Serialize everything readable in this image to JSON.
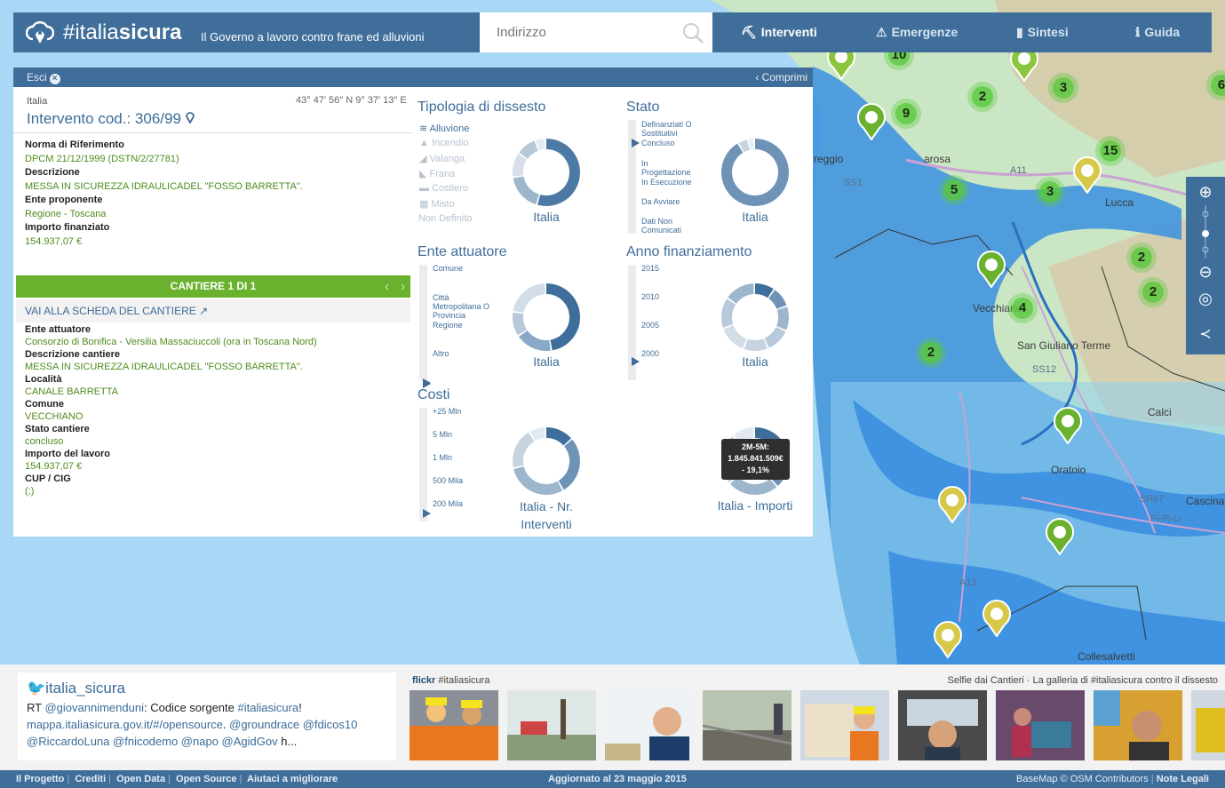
{
  "header": {
    "brand_hash": "#italia",
    "brand_bold": "sicura",
    "tagline": "Il Governo a lavoro contro frane ed alluvioni",
    "search_placeholder": "Indirizzo",
    "nav": [
      {
        "label": "Interventi",
        "icon": "worker-icon",
        "active": true
      },
      {
        "label": "Emergenze",
        "icon": "warning-icon",
        "active": false
      },
      {
        "label": "Sintesi",
        "icon": "bars-icon",
        "active": false
      },
      {
        "label": "Guida",
        "icon": "info-icon",
        "active": false
      }
    ]
  },
  "panel": {
    "exit_label": "Esci",
    "collapse_label": "Comprimi",
    "country": "Italia",
    "coords": "43° 47′ 56″ N 9° 37′ 13″ E",
    "title": "Intervento cod.: 306/99",
    "fields_top": [
      {
        "label": "Norma di Riferimento",
        "value": "DPCM 21/12/1999 (DSTN/2/27781)"
      },
      {
        "label": "Descrizione",
        "value": "MESSA IN SICUREZZA IDRAULICADEL \"FOSSO BARRETTA\"."
      },
      {
        "label": "Ente proponente",
        "value": "Regione - Toscana"
      },
      {
        "label": "Importo finanziato",
        "value": "154.937,07 €"
      }
    ],
    "cantiere_label": "CANTIERE 1 DI 1",
    "scheda_link": "VAI ALLA SCHEDA DEL CANTIERE",
    "fields_bottom": [
      {
        "label": "Ente attuatore",
        "value": "Consorzio di Bonifica - Versilia Massaciuccoli (ora in Toscana Nord)"
      },
      {
        "label": "Descrizione cantiere",
        "value": "MESSA IN SICUREZZA IDRAULICADEL \"FOSSO BARRETTA\"."
      },
      {
        "label": "Località",
        "value": "CANALE BARRETTA"
      },
      {
        "label": "Comune",
        "value": "VECCHIANO"
      },
      {
        "label": "Stato cantiere",
        "value": "concluso"
      },
      {
        "label": "Importo del lavoro",
        "value": "154.937,07 €"
      },
      {
        "label": "CUP / CIG",
        "value": "(;)"
      }
    ]
  },
  "stats": {
    "tipologia": {
      "title": "Tipologia di dissesto",
      "items": [
        "Alluvione",
        "Incendio",
        "Valanga",
        "Frana",
        "Costiero",
        "Misto",
        "Non Definito"
      ],
      "caption": "Italia"
    },
    "stato": {
      "title": "Stato",
      "items": [
        "Definanziati O Sostituitivi",
        "Concluso",
        "In Progettazione",
        "In Esecuzione",
        "Da Avviare",
        "Dati Non Comunicati"
      ],
      "caption": "Italia"
    },
    "ente": {
      "title": "Ente attuatore",
      "items": [
        "Comune",
        "Città Metropolitana O Provincia",
        "Regione",
        "Altro"
      ],
      "caption": "Italia"
    },
    "anno": {
      "title": "Anno finanziamento",
      "items": [
        "2015",
        "2010",
        "2005",
        "2000"
      ],
      "caption": "Italia"
    },
    "costi": {
      "title": "Costi",
      "items": [
        "+25 Mln",
        "5 Mln",
        "1 Mln",
        "500 Mila",
        "200 Mila"
      ],
      "caption_nr": "Italia - Nr. Interventi",
      "caption_imp": "Italia - Importi"
    },
    "tooltip": {
      "line1": "2M-5M:",
      "line2": "1.845.841.509€",
      "line3": "- 19,1%"
    }
  },
  "map": {
    "labels": [
      "Lucca",
      "San Giuliano Terme",
      "Oratoio",
      "Calci",
      "Cascina",
      "Fi-Pi-Li",
      "SR67",
      "A11",
      "SS12",
      "SS1",
      "A12",
      "Collesalvetti",
      "reggio",
      "arosa",
      "Vecchiano"
    ],
    "clusters": [
      "2",
      "3",
      "9",
      "15",
      "5",
      "3",
      "2",
      "2",
      "4",
      "2",
      "10",
      "6"
    ]
  },
  "twitter": {
    "handle": "italia_sicura",
    "prefix": "RT ",
    "mention1": "@giovannimenduni",
    "text1": ": Codice sorgente ",
    "hashtag": "#italiasicura",
    "text2": "!",
    "link": "mappa.italiasicura.gov.it/#/opensource",
    "text3": ". ",
    "mentions": "@groundrace @fdicos10 @RiccardoLuna @fnicodemo @napo @AgidGov",
    "ellipsis": " h..."
  },
  "flickr": {
    "brand": "flickr",
    "tag": " #italiasicura",
    "caption": "Selfie dai Cantieri · La galleria di #italiasicura contro il dissesto"
  },
  "footer": {
    "links": [
      "Il Progetto",
      "Crediti",
      "Open Data",
      "Open Source",
      "Aiutaci a migliorare"
    ],
    "updated": "Aggiornato al 23 maggio 2015",
    "basemap": "BaseMap © OSM Contributors",
    "legal": "Note Legali"
  },
  "colors": {
    "header": "#3f6e9a",
    "accent_green": "#6ab12d",
    "sea": "#a9d7f6",
    "flood": "#3b8fe0"
  }
}
